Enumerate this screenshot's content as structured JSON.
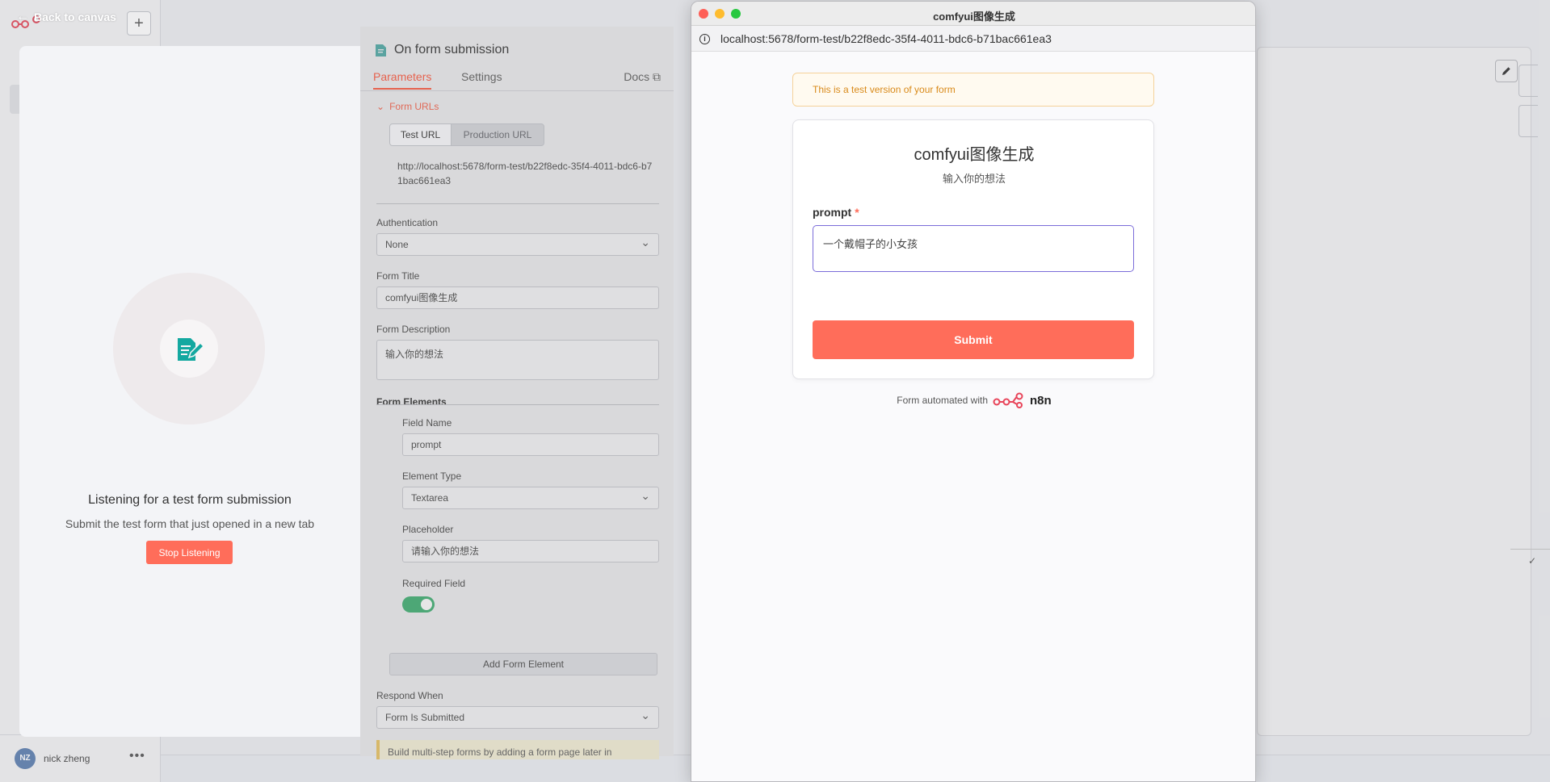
{
  "app": {
    "back_label": "Back to canvas",
    "logo_text": "n8n",
    "user_initials": "NZ",
    "user_name": "nick zheng",
    "user_menu": "•••"
  },
  "listening": {
    "title": "Listening for a test form submission",
    "subtitle": "Submit the test form that just opened in a new tab",
    "stop_label": "Stop Listening"
  },
  "params": {
    "node_title": "On form submission",
    "tabs": [
      "Parameters",
      "Settings",
      "Docs"
    ],
    "form_urls_label": "Form URLs",
    "url_modes": [
      "Test URL",
      "Production URL"
    ],
    "test_url": "http://localhost:5678/form-test/b22f8edc-35f4-4011-bdc6-b71bac661ea3",
    "authentication": {
      "label": "Authentication",
      "value": "None"
    },
    "form_title": {
      "label": "Form Title",
      "value": "comfyui图像生成"
    },
    "form_description": {
      "label": "Form Description",
      "value": "输入你的想法"
    },
    "form_elements_label": "Form Elements",
    "field_name": {
      "label": "Field Name",
      "value": "prompt"
    },
    "element_type": {
      "label": "Element Type",
      "value": "Textarea"
    },
    "placeholder": {
      "label": "Placeholder",
      "value": "请输入你的想法"
    },
    "required_field": {
      "label": "Required Field",
      "on": true
    },
    "add_element_label": "Add Form Element",
    "respond_when": {
      "label": "Respond When",
      "value": "Form Is Submitted"
    },
    "info_text": "Build multi-step forms by adding a form page later in"
  },
  "browser": {
    "window_title": "comfyui图像生成",
    "address": "localhost:5678/form-test/b22f8edc-35f4-4011-bdc6-b71bac661ea3",
    "test_banner": "This is a test version of your form",
    "form": {
      "title": "comfyui图像生成",
      "description": "输入你的想法",
      "field_label": "prompt",
      "required_mark": "*",
      "field_value": "一个戴帽子的小女孩",
      "submit_label": "Submit"
    },
    "footer_text": "Form automated with",
    "footer_brand": "n8n"
  },
  "colors": {
    "accent": "#ff6d5a",
    "focus": "#7b6cd9",
    "toggle_on": "#4da776",
    "banner_text": "#d98a1a"
  }
}
